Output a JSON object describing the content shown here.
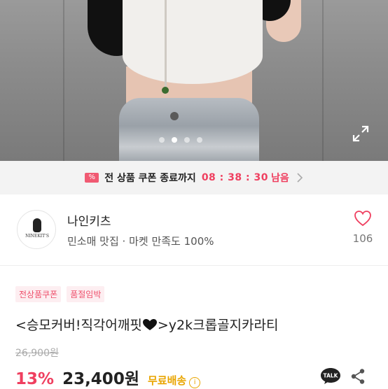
{
  "coupon": {
    "tag": "%",
    "text": "전 상품 쿠폰 종료까지",
    "timer": "08 : 38 : 30",
    "suffix": "남음"
  },
  "seller": {
    "name": "나인키츠",
    "logo_text": "NINEKIT'S",
    "description": "민소매 맛집 · 마켓 만족도 100%",
    "like_count": "106"
  },
  "product": {
    "badges": [
      "전상품쿠폰",
      "품절임박"
    ],
    "title_prefix": "<승모커버!직각어깨핏",
    "title_suffix": ">y2k크롭골지카라티",
    "original_price": "26,900원",
    "discount": "13%",
    "price": "23,400원",
    "shipping": "무료배송",
    "info_icon": "i"
  },
  "gallery": {
    "dot_count": 4,
    "active_index": 1
  },
  "icons": [
    "expand-icon",
    "percent-coupon-icon",
    "chevron-right-icon",
    "heart-outline-icon",
    "black-heart-icon",
    "info-icon",
    "kakaotalk-icon",
    "share-icon"
  ],
  "colors": {
    "accent": "#ef4060",
    "shipping": "#e9a500",
    "badge_bg": "#fdeef1"
  }
}
